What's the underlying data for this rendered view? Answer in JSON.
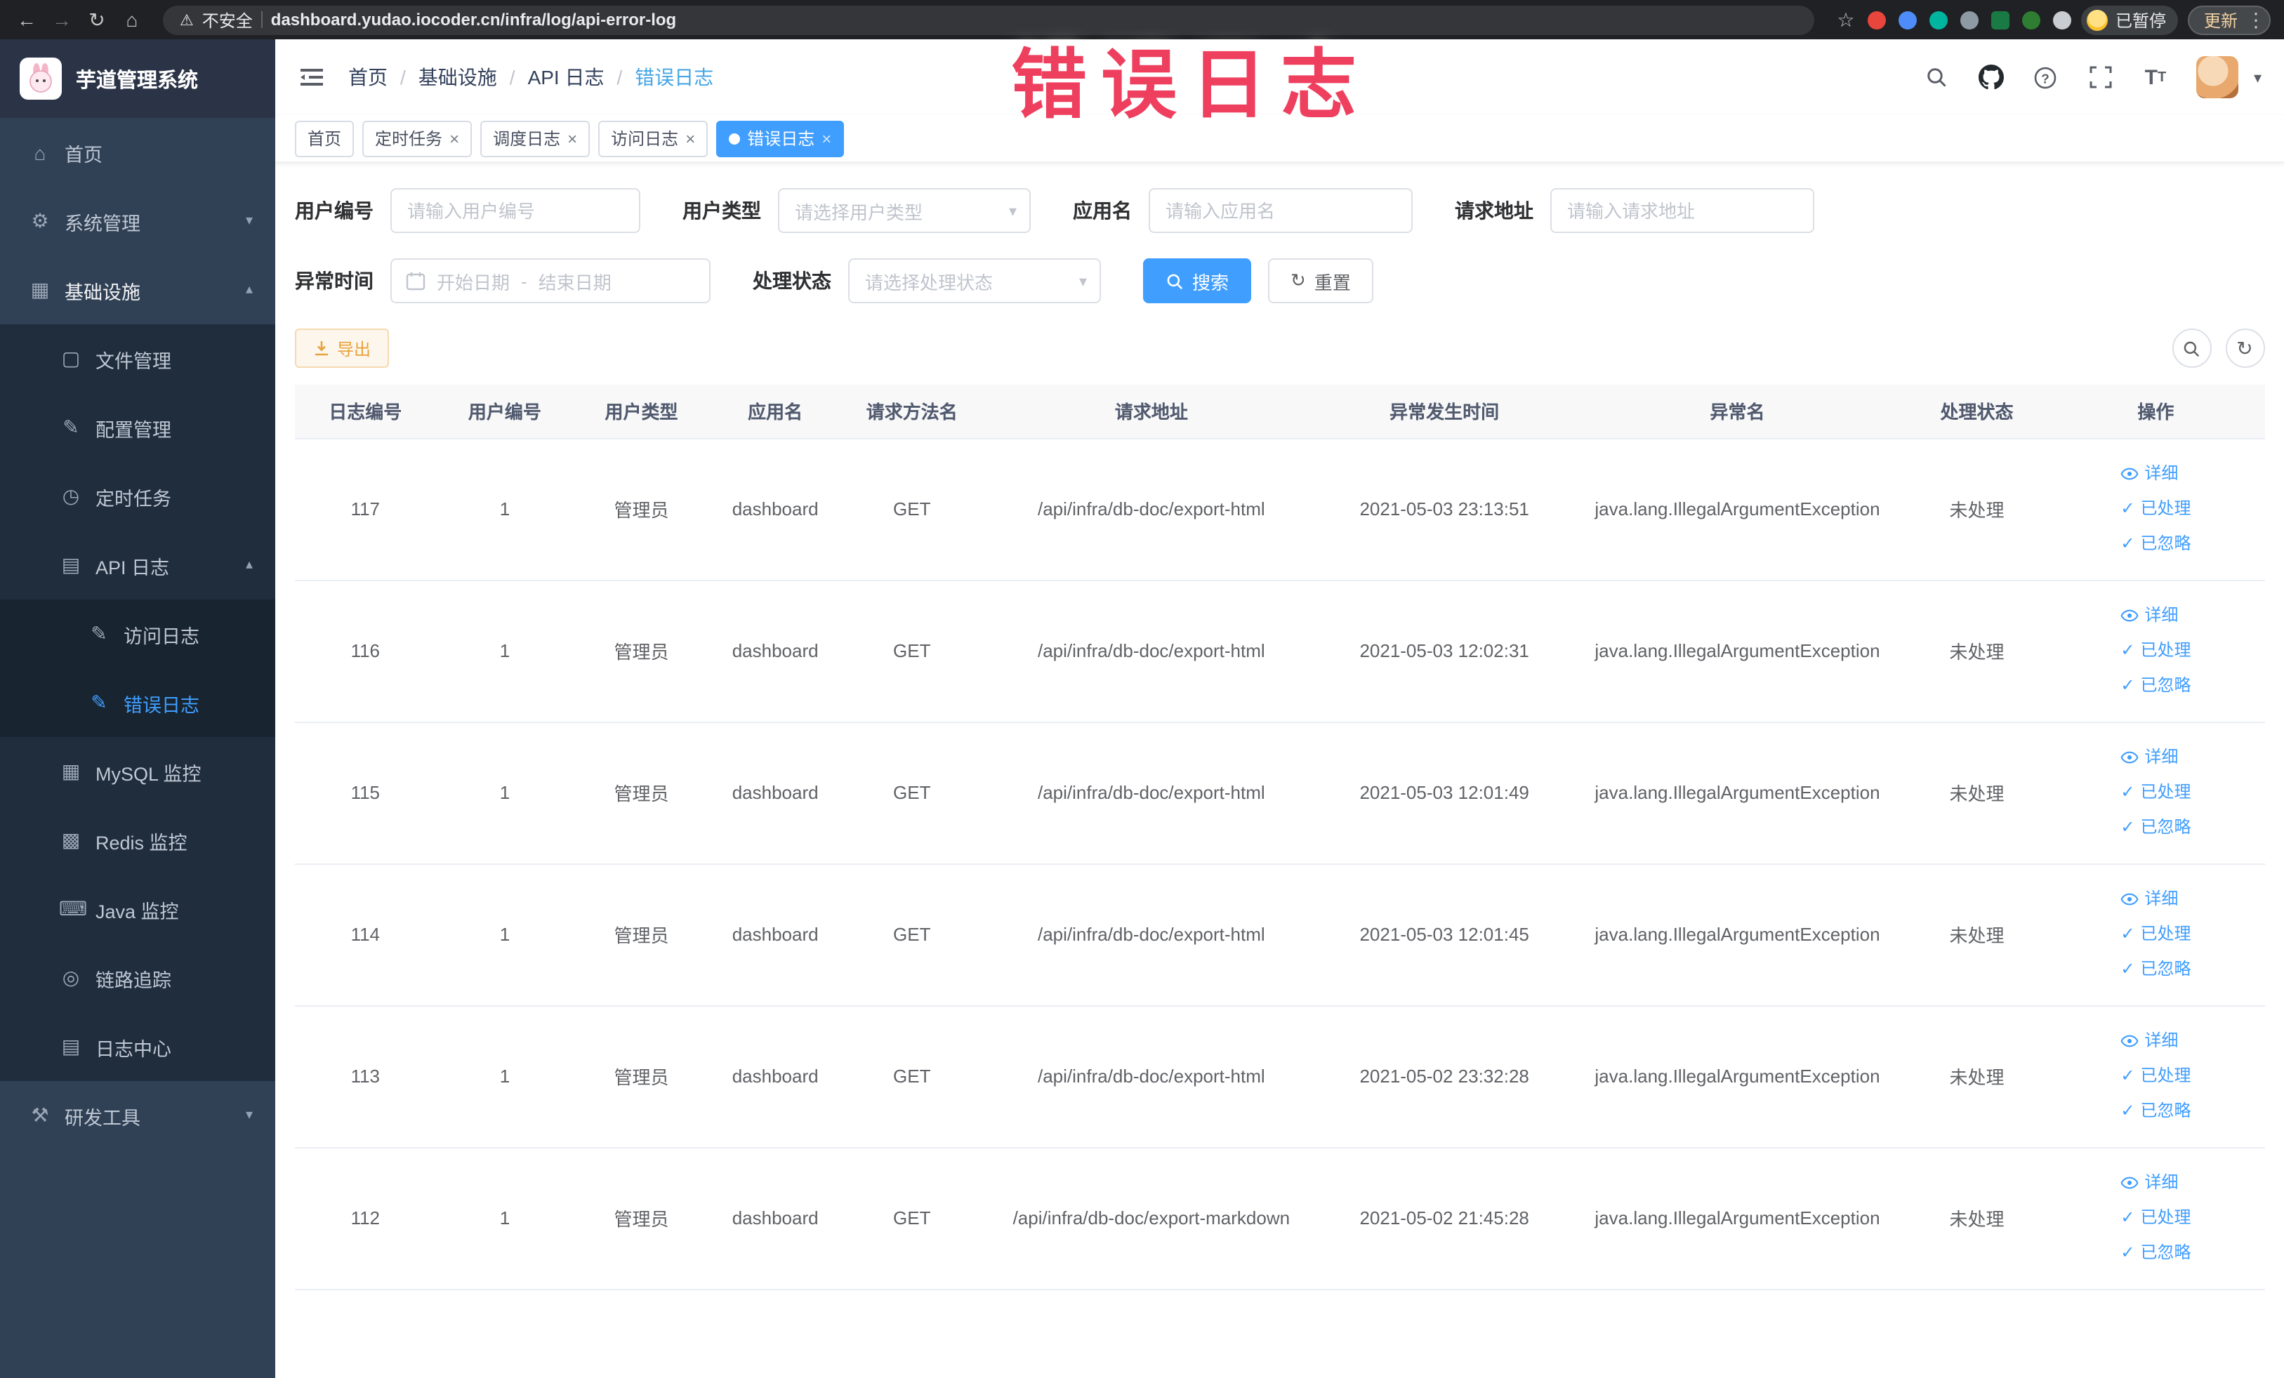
{
  "browser": {
    "security_label": "不安全",
    "url": "dashboard.yudao.iocoder.cn/infra/log/api-error-log",
    "profile_label": "已暂停",
    "update_label": "更新"
  },
  "annotation": "错误日志",
  "sidebar": {
    "logo_title": "芋道管理系统",
    "items": [
      {
        "label": "首页"
      },
      {
        "label": "系统管理"
      },
      {
        "label": "基础设施"
      },
      {
        "label": "文件管理"
      },
      {
        "label": "配置管理"
      },
      {
        "label": "定时任务"
      },
      {
        "label": "API 日志"
      },
      {
        "label": "访问日志"
      },
      {
        "label": "错误日志"
      },
      {
        "label": "MySQL 监控"
      },
      {
        "label": "Redis 监控"
      },
      {
        "label": "Java 监控"
      },
      {
        "label": "链路追踪"
      },
      {
        "label": "日志中心"
      },
      {
        "label": "研发工具"
      }
    ]
  },
  "header": {
    "breadcrumb": [
      "首页",
      "基础设施",
      "API 日志",
      "错误日志"
    ],
    "separator": "/"
  },
  "tags": [
    {
      "label": "首页"
    },
    {
      "label": "定时任务"
    },
    {
      "label": "调度日志"
    },
    {
      "label": "访问日志"
    },
    {
      "label": "错误日志"
    }
  ],
  "filters": {
    "user_id": {
      "label": "用户编号",
      "placeholder": "请输入用户编号"
    },
    "user_type": {
      "label": "用户类型",
      "placeholder": "请选择用户类型"
    },
    "app_name": {
      "label": "应用名",
      "placeholder": "请输入应用名"
    },
    "request_url": {
      "label": "请求地址",
      "placeholder": "请输入请求地址"
    },
    "exception_time": {
      "label": "异常时间",
      "start_placeholder": "开始日期",
      "separator": "-",
      "end_placeholder": "结束日期"
    },
    "process_status": {
      "label": "处理状态",
      "placeholder": "请选择处理状态"
    },
    "search_label": "搜索",
    "reset_label": "重置"
  },
  "toolbar": {
    "export_label": "导出"
  },
  "table": {
    "columns": [
      "日志编号",
      "用户编号",
      "用户类型",
      "应用名",
      "请求方法名",
      "请求地址",
      "异常发生时间",
      "异常名",
      "处理状态",
      "操作"
    ],
    "actions": [
      "详细",
      "已处理",
      "已忽略"
    ],
    "rows": [
      {
        "id": "117",
        "user_id": "1",
        "user_type": "管理员",
        "app": "dashboard",
        "method": "GET",
        "url": "/api/infra/db-doc/export-html",
        "time": "2021-05-03 23:13:51",
        "exception": "java.lang.IllegalArgumentException",
        "status": "未处理"
      },
      {
        "id": "116",
        "user_id": "1",
        "user_type": "管理员",
        "app": "dashboard",
        "method": "GET",
        "url": "/api/infra/db-doc/export-html",
        "time": "2021-05-03 12:02:31",
        "exception": "java.lang.IllegalArgumentException",
        "status": "未处理"
      },
      {
        "id": "115",
        "user_id": "1",
        "user_type": "管理员",
        "app": "dashboard",
        "method": "GET",
        "url": "/api/infra/db-doc/export-html",
        "time": "2021-05-03 12:01:49",
        "exception": "java.lang.IllegalArgumentException",
        "status": "未处理"
      },
      {
        "id": "114",
        "user_id": "1",
        "user_type": "管理员",
        "app": "dashboard",
        "method": "GET",
        "url": "/api/infra/db-doc/export-html",
        "time": "2021-05-03 12:01:45",
        "exception": "java.lang.IllegalArgumentException",
        "status": "未处理"
      },
      {
        "id": "113",
        "user_id": "1",
        "user_type": "管理员",
        "app": "dashboard",
        "method": "GET",
        "url": "/api/infra/db-doc/export-html",
        "time": "2021-05-02 23:32:28",
        "exception": "java.lang.IllegalArgumentException",
        "status": "未处理"
      },
      {
        "id": "112",
        "user_id": "1",
        "user_type": "管理员",
        "app": "dashboard",
        "method": "GET",
        "url": "/api/infra/db-doc/export-markdown",
        "time": "2021-05-02 21:45:28",
        "exception": "java.lang.IllegalArgumentException",
        "status": "未处理"
      }
    ]
  }
}
